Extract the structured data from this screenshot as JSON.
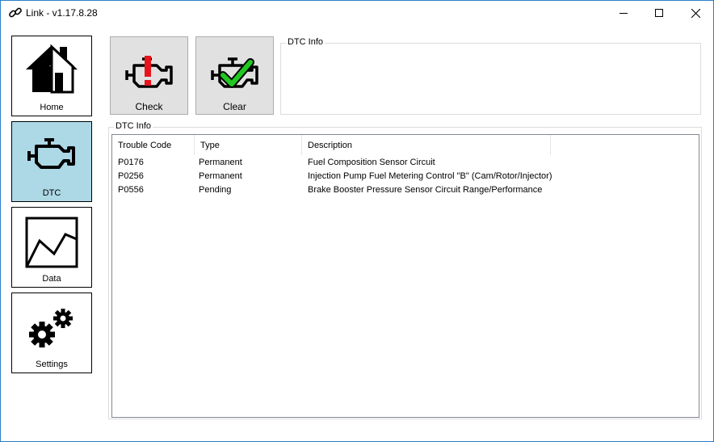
{
  "window": {
    "title": "Link - v1.17.8.28"
  },
  "sidebar": {
    "items": [
      {
        "label": "Home",
        "icon": "home-icon"
      },
      {
        "label": "DTC",
        "icon": "engine-icon",
        "active": true
      },
      {
        "label": "Data",
        "icon": "chart-icon"
      },
      {
        "label": "Settings",
        "icon": "gears-icon"
      }
    ]
  },
  "actions": {
    "check_label": "Check",
    "clear_label": "Clear"
  },
  "top_group": {
    "legend": "DTC Info"
  },
  "list_group": {
    "legend": "DTC Info",
    "columns": [
      "Trouble Code",
      "Type",
      "Description"
    ],
    "rows": [
      {
        "code": "P0176",
        "type": "Permanent",
        "description": "Fuel Composition Sensor Circuit"
      },
      {
        "code": "P0256",
        "type": "Permanent",
        "description": "Injection Pump Fuel Metering Control \"B\" (Cam/Rotor/Injector)"
      },
      {
        "code": "P0556",
        "type": "Pending",
        "description": "Brake Booster Pressure Sensor Circuit Range/Performance"
      }
    ]
  },
  "colors": {
    "active_sidebar": "#add8e6",
    "window_border": "#2b7ec8",
    "warning_red": "#e8141c",
    "ok_green": "#22c822"
  }
}
